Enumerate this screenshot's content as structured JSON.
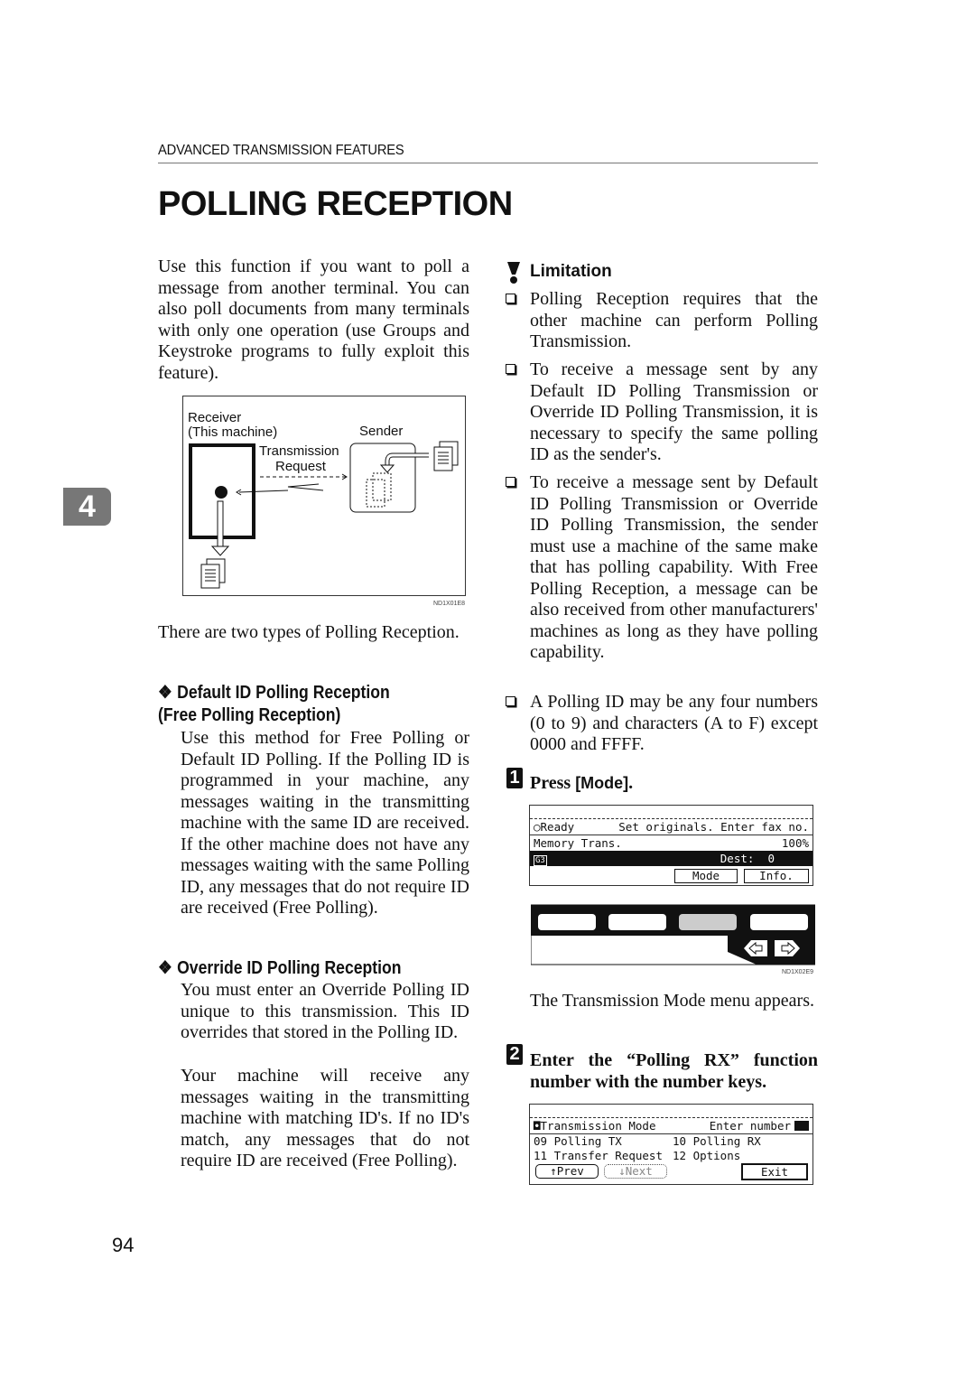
{
  "header": {
    "running_head": "ADVANCED TRANSMISSION FEATURES",
    "title": "POLLING RECEPTION"
  },
  "chapter_tab": "4",
  "page_number": "94",
  "left_column": {
    "intro": "Use this function if you want to poll a message from another terminal. You can also poll documents from many terminals with only one operation (use Groups and Keystroke programs to fully exploit this feature).",
    "figure1": {
      "receiver_label": "Receiver",
      "receiver_sub": "(This machine)",
      "sender_label": "Sender",
      "request_label_1": "Transmission",
      "request_label_2": "Request",
      "code": "ND1X01E8"
    },
    "types_text": "There are two types of Polling Reception.",
    "sections": [
      {
        "icon": "diamond-bullet",
        "heading": "Default ID Polling Reception (Free Polling Reception)",
        "body": "Use this method for Free Polling or Default ID Polling. If the Polling ID is programmed in your machine, any messages waiting in the transmitting machine with the same ID are received. If the other machine does not have any messages waiting with the same Polling ID, any messages that do not require ID are received (Free Polling)."
      },
      {
        "icon": "diamond-bullet",
        "heading": "Override ID Polling Reception",
        "body": "You must enter an Override Polling ID unique to this transmission. This ID overrides that stored in the Polling ID.",
        "body2": "Your machine will receive any messages waiting in the transmitting machine with matching ID's. If no ID's match, any messages that do not require ID are received (Free Polling)."
      }
    ]
  },
  "right_column": {
    "limitation": {
      "icon": "limitation-icon",
      "heading": "Limitation",
      "items": [
        "Polling Reception requires that the other machine can perform Polling Transmission.",
        "To receive a message sent by any Default ID Polling Transmission or Override ID Polling Transmission, it is necessary to specify the same polling ID as the sender's.",
        "To receive a message sent by Default ID Polling Transmission or Override ID Polling Transmission, the sender must use a machine of the same make that has polling capability. With Free Polling Reception, a message can be also received from other manufacturers' machines as long as they have polling capability.",
        "A Polling ID may be any four numbers (0 to 9) and characters (A to F) except 0000 and FFFF."
      ]
    },
    "steps": [
      {
        "number": "1",
        "text_prefix": "Press ",
        "key": "[Mode]",
        "text_suffix": "."
      },
      {
        "number": "2",
        "text": "Enter the “Polling RX” function number with the number keys."
      }
    ],
    "lcd1": {
      "ready": "Ready",
      "ready_msg": "Set originals. Enter fax no.",
      "mode_line": "Memory Trans.",
      "percent": "100%",
      "g3": "G3",
      "dest": "Dest:  0",
      "mode_btn": "Mode",
      "info_btn": "Info."
    },
    "panel_code": "ND1X02E9",
    "after_step1": "The Transmission Mode menu appears.",
    "lcd2": {
      "title": "Transmission Mode",
      "prompt": "Enter number",
      "item_09": "09 Polling TX",
      "item_10": "10 Polling RX",
      "item_11": "11 Transfer Request",
      "item_12": "12 Options",
      "prev_btn": "↑Prev",
      "next_btn": "↓Next",
      "exit_btn": "Exit"
    }
  }
}
